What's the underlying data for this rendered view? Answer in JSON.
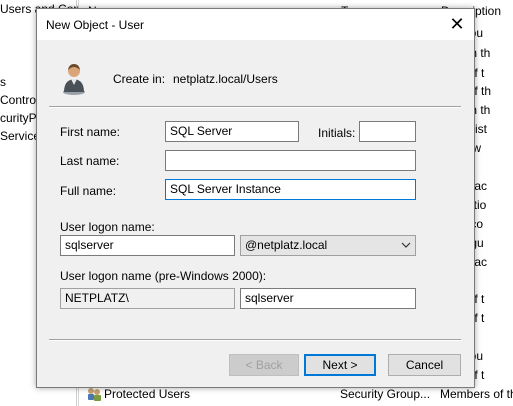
{
  "background": {
    "left_lines": [
      "Users and Com",
      "s",
      "Controlle",
      "curityPr",
      "Service"
    ],
    "col2_top": "N",
    "col2_right_top": "T",
    "right_lines": [
      "Description",
      "n accou",
      "bers in th",
      "bers of t",
      "bers of th",
      "bers in th",
      "Administ",
      "lients w",
      "nated ac",
      "orkstatio",
      "main co",
      "main gu",
      "nated ac",
      "bers of t",
      "bers of t",
      "n accou",
      "bers of t"
    ],
    "bottom_row": {
      "name": "Protected Users",
      "type": "Security Group...",
      "description": "Members of th"
    }
  },
  "dialog": {
    "title": "New Object - User",
    "close_glyph": "✕",
    "create_in_label": "Create in:",
    "create_in_value": "netplatz.local/Users",
    "first_name_label": "First name:",
    "first_name_value": "SQL Server",
    "initials_label": "Initials:",
    "initials_value": "",
    "last_name_label": "Last name:",
    "last_name_value": "",
    "full_name_label": "Full name:",
    "full_name_value": "SQL Server Instance",
    "logon_name_label": "User logon name:",
    "logon_name_value": "sqlserver",
    "domain_value": "@netplatz.local",
    "pre2000_label": "User logon name (pre-Windows 2000):",
    "pre2000_domain": "NETPLATZ\\",
    "pre2000_value": "sqlserver",
    "back_label": "< Back",
    "next_label": "Next >",
    "cancel_label": "Cancel"
  },
  "icons": {
    "user": "user-icon",
    "group": "group-icon",
    "dropdown": "chevron-down-icon"
  }
}
